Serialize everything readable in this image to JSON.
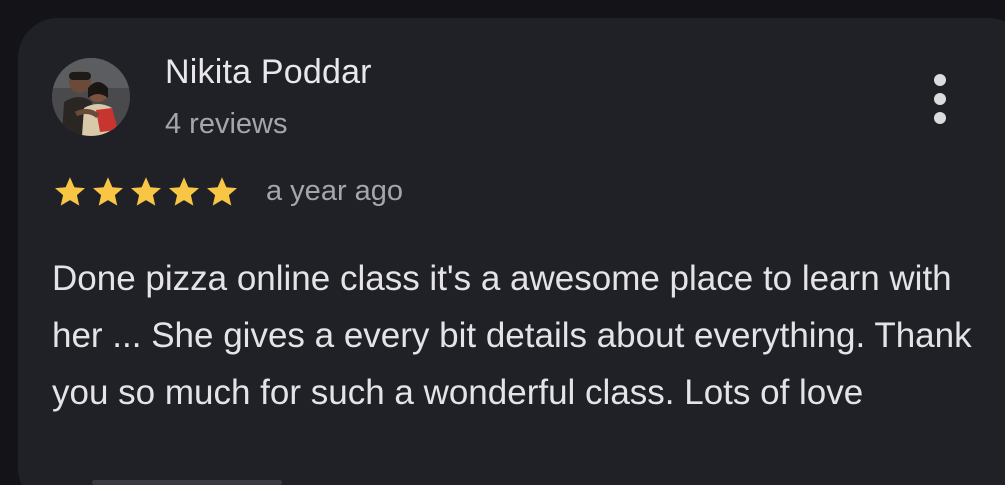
{
  "review": {
    "author_name": "Nikita Poddar",
    "author_reviews": "4 reviews",
    "rating": 5,
    "rating_max": 5,
    "star_color": "#f8c644",
    "date": "a year ago",
    "text": "Done pizza online class it's a awesome place to learn with her ... She gives a every bit details about everything. Thank you so much for such a wonderful class. Lots of love"
  },
  "icons": {
    "more": "more-vert-icon",
    "star": "star-icon",
    "avatar": "avatar"
  }
}
